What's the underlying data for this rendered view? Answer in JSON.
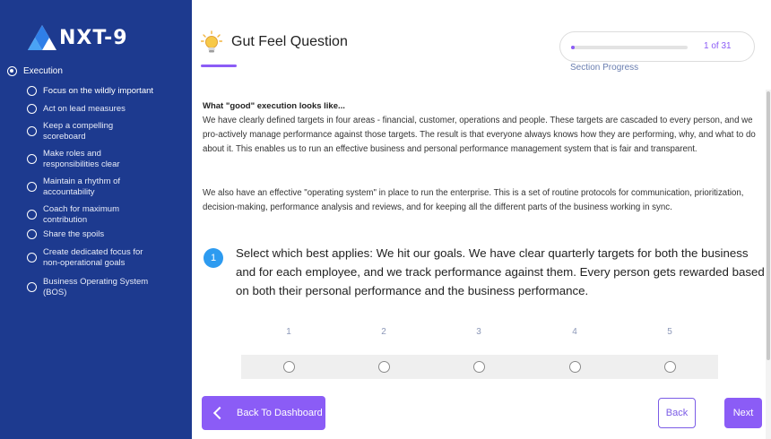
{
  "brand": {
    "name": "NXT-9"
  },
  "sidebar": {
    "section_label": "Execution",
    "items": [
      {
        "label": "Focus on the wildly important"
      },
      {
        "label": "Act on lead measures"
      },
      {
        "label": "Keep a compelling scoreboard"
      },
      {
        "label": "Make roles and responsibilities clear"
      },
      {
        "label": "Maintain a rhythm of accountability"
      },
      {
        "label": "Coach for maximum contribution"
      },
      {
        "label": "Share the spoils"
      },
      {
        "label": "Create dedicated focus for non-operational goals"
      },
      {
        "label": "Business Operating System (BOS)"
      }
    ]
  },
  "header": {
    "title": "Gut Feel Question",
    "progress_text": "1 of 31",
    "progress_value": 0.032,
    "progress_label": "Section Progress"
  },
  "main": {
    "intro_title": "What \"good\" execution looks like...",
    "paragraph1": "We have clearly defined targets in four areas - financial, customer, operations and people. These targets are cascaded to every person, and we pro-actively manage performance against those targets. The result is that everyone always knows how they are performing, why, and what to do about it. This enables us to run an effective business and personal performance management system that is fair and transparent.",
    "paragraph2": "We also have an effective \"operating system\" in place to run the enterprise. This is a set of routine protocols for communication, prioritization, decision-making, performance analysis and reviews, and for keeping all the different parts of the business working in sync.",
    "question_number": "1",
    "question_text": "Select which best applies: We hit our goals. We have clear quarterly targets for both the business and for each employee, and we track performance against them. Every person gets rewarded based on both their personal performance and the business performance.",
    "scale": [
      "1",
      "2",
      "3",
      "4",
      "5"
    ]
  },
  "footer": {
    "back_to_dashboard": "Back To Dashboard",
    "back": "Back",
    "next": "Next"
  },
  "colors": {
    "sidebar_bg": "#1d3a8f",
    "accent": "#8b5cf6",
    "question_badge": "#2d9bf0"
  }
}
